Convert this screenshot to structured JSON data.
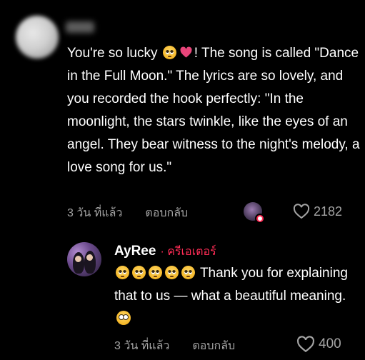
{
  "comment": {
    "text_before_emoji": "You're so lucky ",
    "text_line_rest": "! The song is called \"Dance in the Full Moon.\" The lyrics are so lovely, and you recorded the hook perfectly: \"In the moonlight, the stars twinkle, like the eyes of an angel. They bear witness to the night's melody, a love song for us.\"",
    "time_ago": "3 วัน ที่แล้ว",
    "reply_label": "ตอบกลับ",
    "like_count": "2182",
    "emojis": [
      "pleading-face-icon",
      "heart-icon"
    ]
  },
  "reply": {
    "username": "AyRee",
    "creator_tag": "· ครีเอเตอร์",
    "emoji_count": 5,
    "text": "Thank you for explaining that to us — what a beautiful meaning.",
    "time_ago": "3 วัน ที่แล้ว",
    "reply_label": "ตอบกลับ",
    "like_count": "400"
  },
  "colors": {
    "background": "#000000",
    "text": "#ffffff",
    "meta": "#a3a3a3",
    "creator_accent": "#fe2c55",
    "heart_emoji": "#e8457a"
  }
}
